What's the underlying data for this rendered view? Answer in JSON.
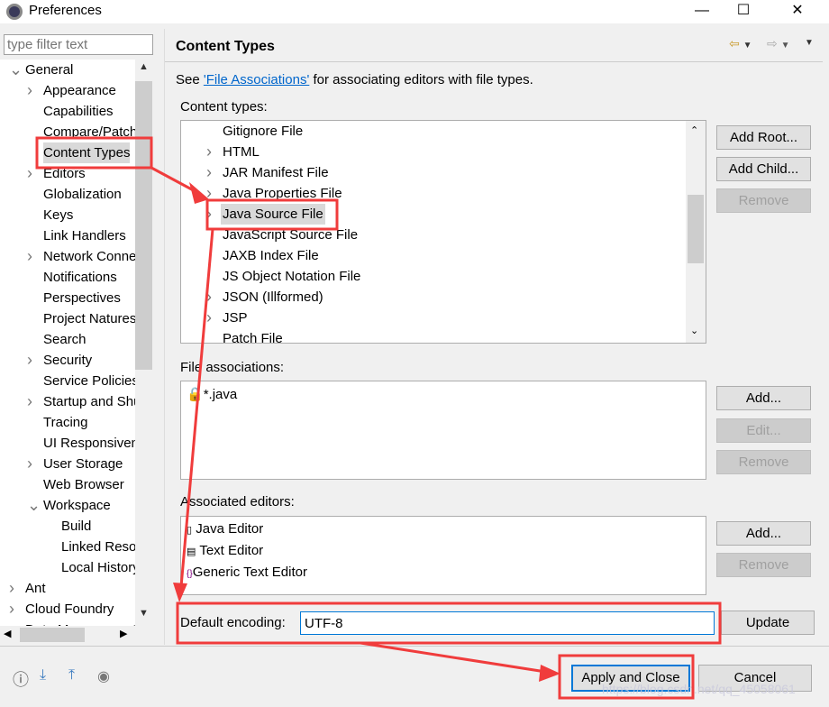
{
  "window": {
    "title": "Preferences",
    "minimize": "—",
    "maximize": "☐",
    "close": "✕"
  },
  "filter": {
    "placeholder": "type filter text"
  },
  "tree": [
    {
      "label": "General",
      "level": 0,
      "chev": "v"
    },
    {
      "label": "Appearance",
      "level": 1,
      "chev": ">"
    },
    {
      "label": "Capabilities",
      "level": 1
    },
    {
      "label": "Compare/Patch",
      "level": 1
    },
    {
      "label": "Content Types",
      "level": 1,
      "selected": true
    },
    {
      "label": "Editors",
      "level": 1,
      "chev": ">"
    },
    {
      "label": "Globalization",
      "level": 1
    },
    {
      "label": "Keys",
      "level": 1
    },
    {
      "label": "Link Handlers",
      "level": 1
    },
    {
      "label": "Network Connections",
      "level": 1,
      "chev": ">"
    },
    {
      "label": "Notifications",
      "level": 1
    },
    {
      "label": "Perspectives",
      "level": 1
    },
    {
      "label": "Project Natures",
      "level": 1
    },
    {
      "label": "Search",
      "level": 1
    },
    {
      "label": "Security",
      "level": 1,
      "chev": ">"
    },
    {
      "label": "Service Policies",
      "level": 1
    },
    {
      "label": "Startup and Shutdown",
      "level": 1,
      "chev": ">"
    },
    {
      "label": "Tracing",
      "level": 1
    },
    {
      "label": "UI Responsiveness",
      "level": 1
    },
    {
      "label": "User Storage",
      "level": 1,
      "chev": ">"
    },
    {
      "label": "Web Browser",
      "level": 1
    },
    {
      "label": "Workspace",
      "level": 1,
      "chev": "v"
    },
    {
      "label": "Build",
      "level": 2
    },
    {
      "label": "Linked Resources",
      "level": 2
    },
    {
      "label": "Local History",
      "level": 2
    },
    {
      "label": "Ant",
      "level": 0,
      "chev": ">"
    },
    {
      "label": "Cloud Foundry",
      "level": 0,
      "chev": ">"
    },
    {
      "label": "Data Management",
      "level": 0,
      "chev": ">"
    }
  ],
  "page": {
    "title": "Content Types",
    "desc_prefix": "See ",
    "desc_link": "'File Associations'",
    "desc_suffix": " for associating editors with file types.",
    "content_types_label": "Content types:",
    "content_types": [
      {
        "label": "Gitignore File"
      },
      {
        "label": "HTML",
        "chev": ">"
      },
      {
        "label": "JAR Manifest File",
        "chev": ">"
      },
      {
        "label": "Java Properties File",
        "chev": ">"
      },
      {
        "label": "Java Source File",
        "chev": ">",
        "selected": true
      },
      {
        "label": "JavaScript Source File"
      },
      {
        "label": "JAXB Index File"
      },
      {
        "label": "JS Object Notation File"
      },
      {
        "label": "JSON (Illformed)",
        "chev": ">"
      },
      {
        "label": "JSP",
        "chev": ">"
      },
      {
        "label": "Patch File"
      }
    ],
    "add_root": "Add Root...",
    "add_child": "Add Child...",
    "remove": "Remove",
    "file_assoc_label": "File associations:",
    "file_assocs": [
      "*.java"
    ],
    "fa_add": "Add...",
    "fa_edit": "Edit...",
    "fa_remove": "Remove",
    "assoc_editors_label": "Associated editors:",
    "editors": [
      "Java Editor",
      "Text Editor",
      "Generic Text Editor"
    ],
    "ed_add": "Add...",
    "ed_remove": "Remove",
    "encoding_label": "Default encoding:",
    "encoding_value": "UTF-8",
    "update": "Update"
  },
  "footer": {
    "apply_close": "Apply and Close",
    "cancel": "Cancel"
  },
  "watermark": "https://blog.csdn.net/qq_45058061",
  "colors": {
    "annotation": "#f03c3c",
    "focus": "#0078d7",
    "link": "#0066cc"
  }
}
